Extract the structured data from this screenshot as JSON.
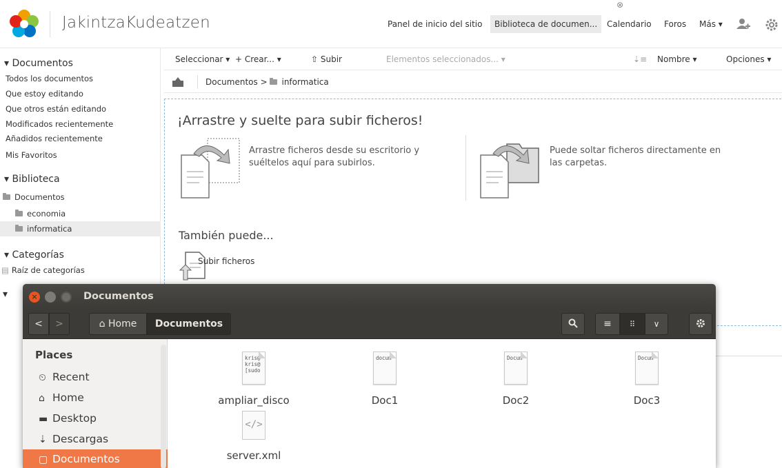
{
  "browser": {
    "site_title": "JakintzaKudeatzen",
    "nav": {
      "dashboard": "Panel de inicio del sitio",
      "library": "Biblioteca de documen...",
      "calendar": "Calendario",
      "forums": "Foros",
      "more": "Más ▾"
    },
    "close_glyph": "⊗",
    "sidebar": {
      "documents_header": "▾ Documentos",
      "documents_links": [
        "Todos los documentos",
        "Que estoy editando",
        "Que otros están editando",
        "Modificados recientemente",
        "Añadidos recientemente",
        "Mis Favoritos"
      ],
      "library_header": "▾ Biblioteca",
      "tree": [
        "Documentos",
        "economia",
        "informatica"
      ],
      "selected_folder": "informatica",
      "categories_header": "▾ Categorías",
      "categories_root": "Raíz de categorías",
      "collapsed_marker": "▾"
    },
    "toolbar": {
      "select": "Seleccionar ▾",
      "create": "+ Crear... ▾",
      "upload": "⇧ Subir",
      "selected_items": "Elementos seleccionados... ▾",
      "sort_icon": "⇣≡",
      "name": "Nombre ▾",
      "options": "Opciones ▾"
    },
    "breadcrumb": {
      "root": "Documentos",
      "separator": ">",
      "current": "informatica"
    },
    "dropzone": {
      "title": "¡Arrastre y suelte para subir ficheros!",
      "desktop_line1": "Arrastre ficheros desde su escritorio y",
      "desktop_line2": "suéltelos aquí para subirlos.",
      "folder_line1": "Puede soltar ficheros directamente en",
      "folder_line2": "las carpetas.",
      "also": "También puede...",
      "upload_files": "Subir ficheros"
    },
    "colors": {
      "dropzone_border": "#8cb8d8",
      "selected_bg": "#ececec"
    }
  },
  "nautilus": {
    "window_title": "Documentos",
    "path": {
      "home": "Home",
      "current": "Documentos"
    },
    "places": {
      "title": "Places",
      "items": [
        {
          "icon": "clock-icon",
          "glyph": "⏲",
          "label": "Recent"
        },
        {
          "icon": "home-icon",
          "glyph": "⌂",
          "label": "Home"
        },
        {
          "icon": "desktop-folder-icon",
          "glyph": "▬",
          "label": "Desktop"
        },
        {
          "icon": "download-icon",
          "glyph": "⇣",
          "label": "Descargas"
        },
        {
          "icon": "document-icon",
          "glyph": "▢",
          "label": "Documentos"
        }
      ],
      "selected": "Documentos"
    },
    "files": [
      {
        "name": "ampliar_disco",
        "preview": "kris@\nkris@\n[sudo",
        "type": "text"
      },
      {
        "name": "Doc1",
        "preview": "docum",
        "type": "text"
      },
      {
        "name": "Doc2",
        "preview": "Docum",
        "type": "text"
      },
      {
        "name": "Doc3",
        "preview": "Docum",
        "type": "text"
      },
      {
        "name": "server.xml",
        "preview": "</>",
        "type": "xml"
      }
    ],
    "colors": {
      "accent": "#f07746",
      "titlebar": "#3c3b37",
      "close_button": "#e95420"
    }
  }
}
